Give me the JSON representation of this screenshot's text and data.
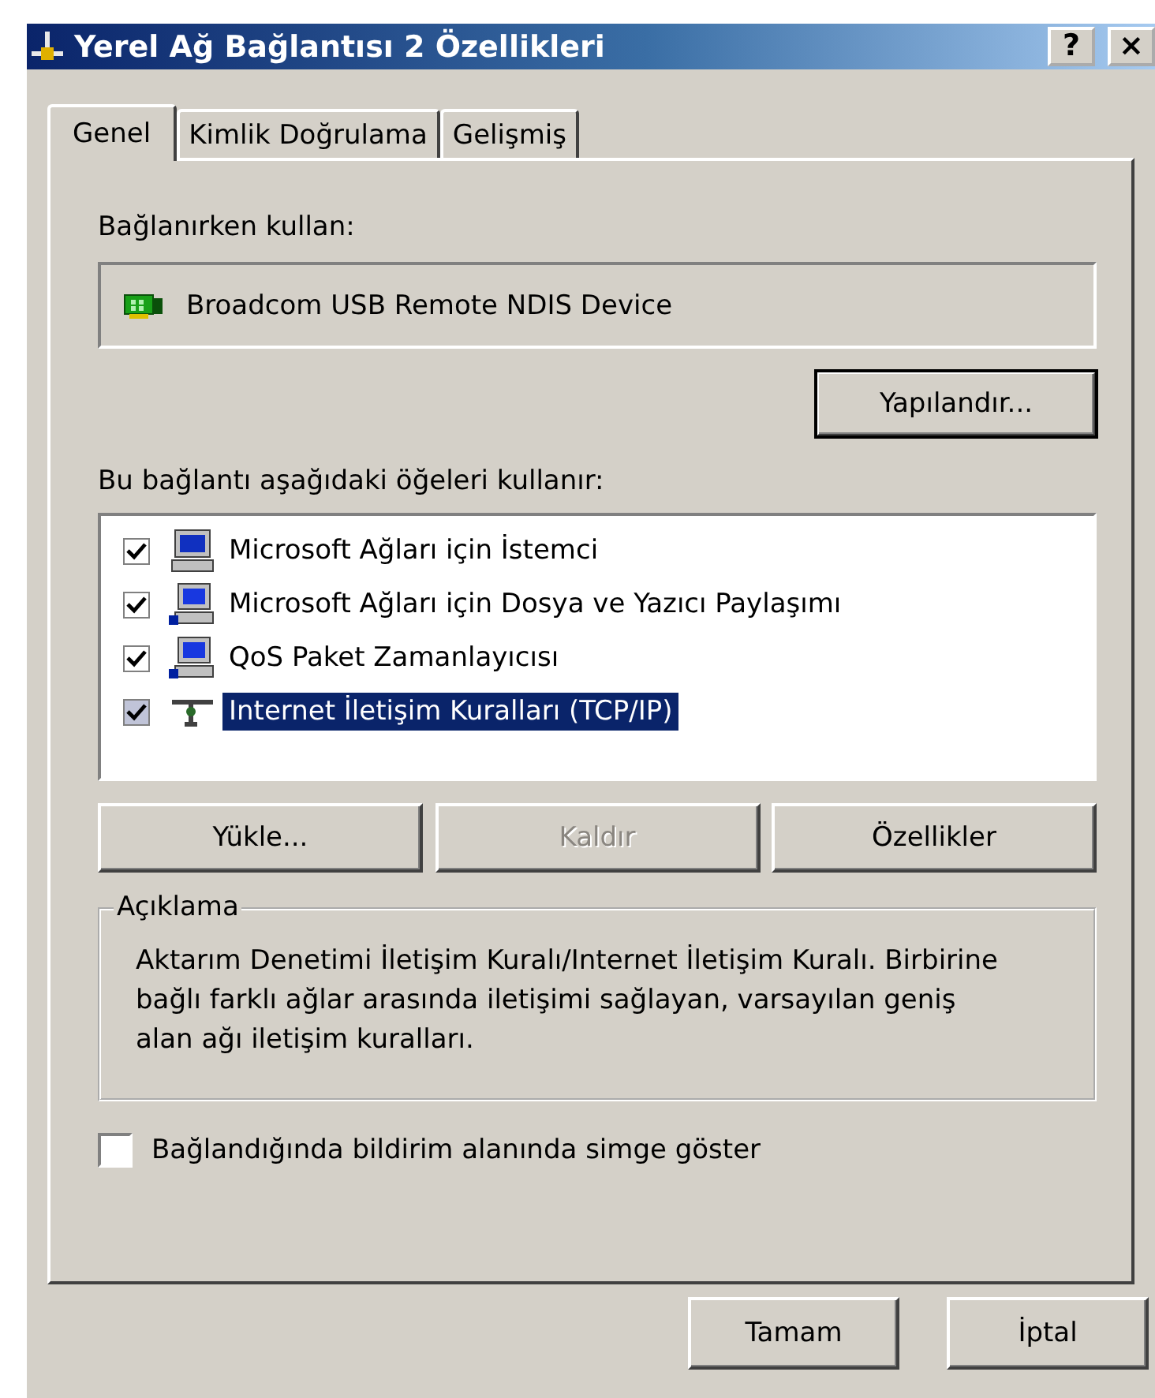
{
  "window": {
    "title": "Yerel Ağ Bağlantısı 2 Özellikleri",
    "buttons": [
      {
        "label": "?"
      },
      {
        "label": "×"
      }
    ]
  },
  "tabs": [
    {
      "label": "Genel",
      "selected": true
    },
    {
      "label": "Kimlik Doğrulama",
      "selected": false
    },
    {
      "label": "Gelişmiş",
      "selected": false
    }
  ],
  "connect_using": {
    "label": "Bağlanırken kullan:",
    "device": "Broadcom USB Remote NDIS Device",
    "configure_button": "Yapılandır..."
  },
  "components": {
    "label": "Bu bağlantı aşağıdaki öğeleri kullanır:",
    "items": [
      {
        "label": "Microsoft Ağları için İstemci",
        "checked": true,
        "selected": false,
        "kind": "client"
      },
      {
        "label": "Microsoft Ağları için Dosya ve Yazıcı Paylaşımı",
        "checked": true,
        "selected": false,
        "kind": "service"
      },
      {
        "label": "QoS Paket Zamanlayıcısı",
        "checked": true,
        "selected": false,
        "kind": "service"
      },
      {
        "label": "Internet İletişim Kuralları (TCP/IP)",
        "checked": true,
        "selected": true,
        "kind": "protocol"
      }
    ],
    "buttons": [
      {
        "label": "Yükle...",
        "disabled": false
      },
      {
        "label": "Kaldır",
        "disabled": true
      },
      {
        "label": "Özellikler",
        "disabled": false
      }
    ]
  },
  "description": {
    "title": "Açıklama",
    "text": "Aktarım Denetimi İletişim Kuralı/Internet İletişim Kuralı. Birbirine bağlı farklı ağlar arasında iletişimi sağlayan, varsayılan geniş alan ağı iletişim kuralları."
  },
  "notify_checkbox": {
    "label": "Bağlandığında bildirim alanında simge göster",
    "checked": false
  },
  "footer_buttons": [
    {
      "label": "Tamam"
    },
    {
      "label": "İptal"
    }
  ]
}
